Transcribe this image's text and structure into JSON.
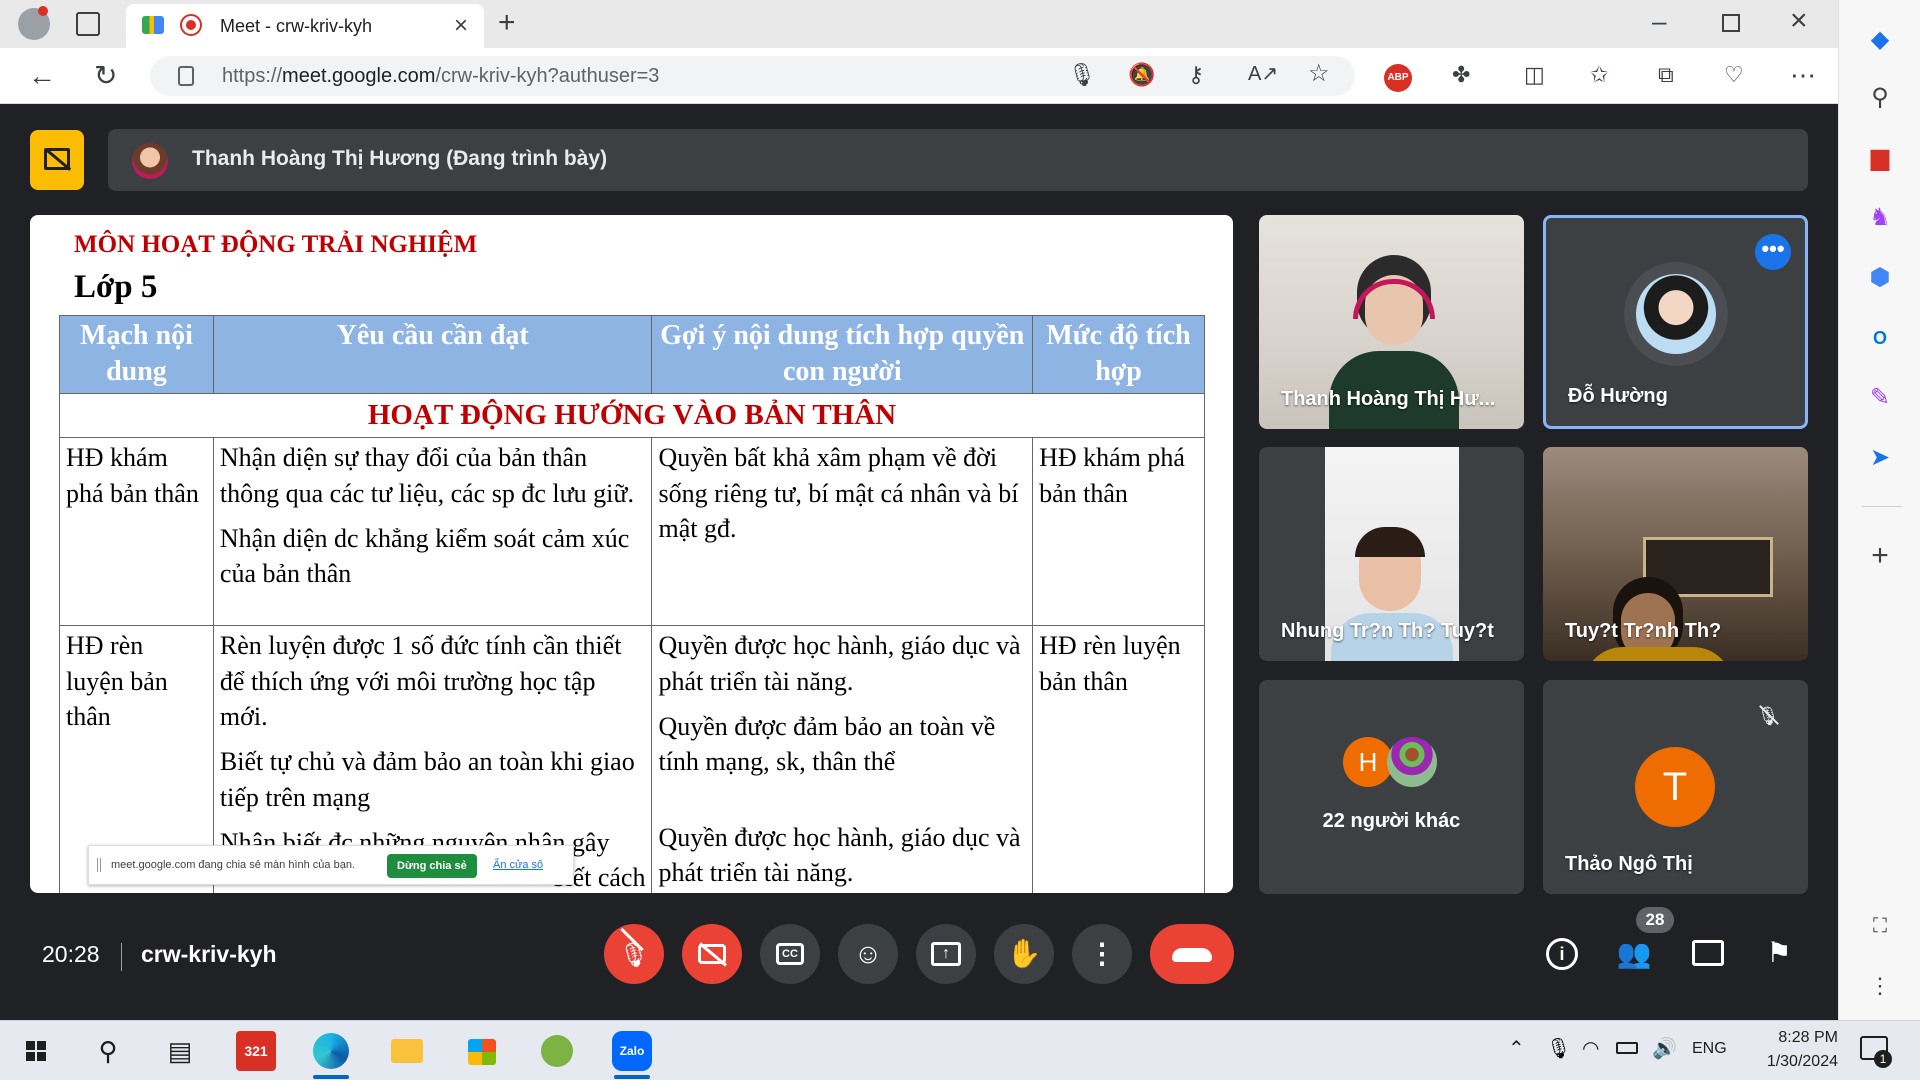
{
  "browser": {
    "tab_title": "Meet - crw-kriv-kyh",
    "url_base": "https://",
    "url_host": "meet.google.com",
    "url_path": "/crw-kriv-kyh?authuser=3",
    "adblock_badge": "ABP"
  },
  "meet": {
    "presenter_banner": "Thanh Hoàng Thị Hương (Đang trình bày)",
    "time": "20:28",
    "meeting_code": "crw-kriv-kyh",
    "participant_count": "28",
    "share_notice": {
      "text": "meet.google.com đang chia sẻ màn hình của bạn.",
      "stop_button": "Dừng chia sẻ",
      "hide_link": "Ẩn cửa số"
    },
    "tiles": [
      {
        "name": "Thanh Hoàng Thị Hư..."
      },
      {
        "name": "Đỗ Hường"
      },
      {
        "name": "Nhung Tr?n Th? Tuy?t"
      },
      {
        "name": "Tuy?t Tr?nh Th?"
      },
      {
        "name": "22 người khác",
        "avatar_letter": "H"
      },
      {
        "name": "Thảo Ngô Thị",
        "avatar_letter": "T"
      }
    ]
  },
  "slide": {
    "subject": "MÔN HOẠT ĐỘNG TRẢI NGHIỆM",
    "grade": "Lớp 5",
    "headers": [
      "Mạch nội dung",
      "Yêu cầu cần đạt",
      "Gợi ý nội dung tích hợp quyền con người",
      "Mức độ tích hợp"
    ],
    "section": "HOẠT ĐỘNG HƯỚNG VÀO BẢN THÂN",
    "rows": [
      {
        "content": "HĐ khám phá bản thân",
        "requirements": [
          "Nhận diện sự thay đổi của bản thân thông qua các tư liệu, các sp đc lưu giữ.",
          "Nhận diện dc khẳng kiểm soát cảm xúc của bản thân"
        ],
        "rights": [
          "Quyền bất khả xâm phạm về đời sống riêng tư, bí mật cá nhân và bí mật gđ."
        ],
        "level": "HĐ khám phá bản thân"
      },
      {
        "content": "HĐ rèn luyện bản thân",
        "requirements": [
          "Rèn luyện được 1 số đức tính cần thiết để thích ứng với môi trường học tập mới.",
          "Biết tự chủ và đảm bảo an toàn khi giao tiếp trên mạng",
          "Nhận biết đc những nguyên nhân gây"
        ],
        "requirements_trailing": "biết cách",
        "rights": [
          "Quyền được học hành, giáo dục và phát triển tài năng.",
          "Quyền được đảm bảo an toàn về tính mạng, sk, thân thể",
          "Quyền được học hành, giáo dục và phát triển tài năng."
        ],
        "level": "HĐ rèn luyện bản thân"
      }
    ]
  },
  "taskbar": {
    "language": "ENG",
    "clock_time": "8:28 PM",
    "clock_date": "1/30/2024",
    "notification_count": "1",
    "app_zalo": "Zalo",
    "app_calendar": "321"
  },
  "colors": {
    "meet_bg": "#202124",
    "tile_bg": "#3c4043",
    "end_call_red": "#ea4335",
    "present_yellow": "#fbbc04",
    "header_blue": "#8eb4e3",
    "slide_red": "#c00000",
    "active_border": "#8ab4f8",
    "avatar_orange": "#ef6c00"
  }
}
